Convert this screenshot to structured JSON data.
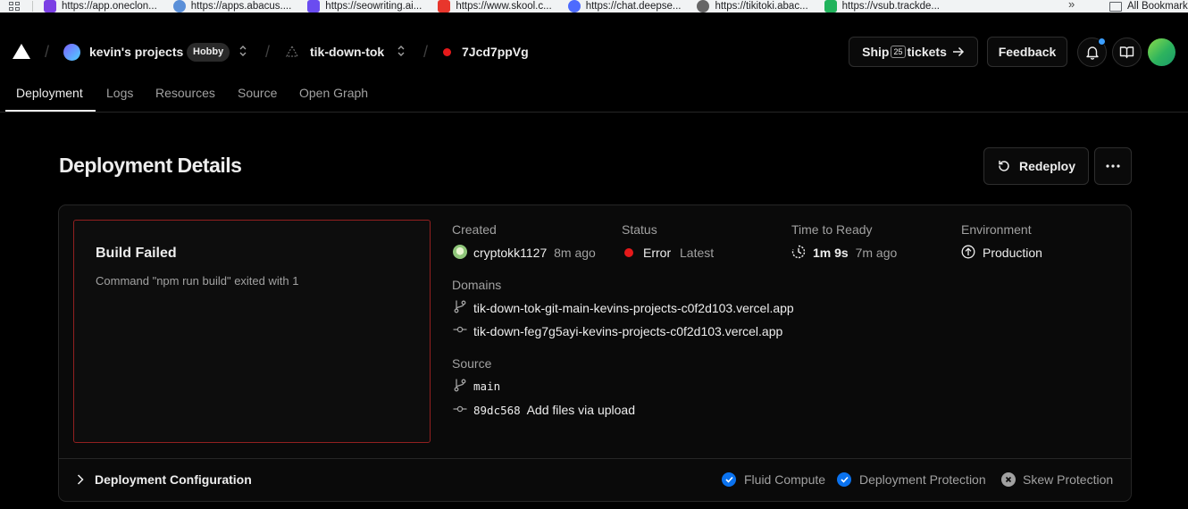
{
  "bookmarks": [
    {
      "label": "https://app.oneclon...",
      "color": "#7b3fe4"
    },
    {
      "label": "https://apps.abacus....",
      "color": "#5a8fd8"
    },
    {
      "label": "https://seowriting.ai...",
      "color": "#6a4cf0"
    },
    {
      "label": "https://www.skool.c...",
      "color": "#e8362c"
    },
    {
      "label": "https://chat.deepse...",
      "color": "#4d6bfe"
    },
    {
      "label": "https://tikitoki.abac...",
      "color": "#666666"
    },
    {
      "label": "https://vsub.trackde...",
      "color": "#21b35c"
    }
  ],
  "bookmarks_more": "»",
  "bookmarks_folder": "All Bookmarks",
  "header": {
    "team": "kevin's projects",
    "plan": "Hobby",
    "project": "tik-down-tok",
    "deployment_id": "7Jcd7ppVg",
    "ship_label_pre": "Ship",
    "ship_number": "25",
    "ship_label_post": "tickets",
    "feedback": "Feedback"
  },
  "tabs": [
    "Deployment",
    "Logs",
    "Resources",
    "Source",
    "Open Graph"
  ],
  "page_title": "Deployment Details",
  "actions": {
    "redeploy": "Redeploy"
  },
  "build": {
    "title": "Build Failed",
    "message": "Command \"npm run build\" exited with 1"
  },
  "details": {
    "created_label": "Created",
    "created_user": "cryptokk1127",
    "created_ago": "8m ago",
    "status_label": "Status",
    "status_value": "Error",
    "status_tag": "Latest",
    "ready_label": "Time to Ready",
    "ready_value": "1m 9s",
    "ready_ago": "7m ago",
    "env_label": "Environment",
    "env_value": "Production",
    "domains_label": "Domains",
    "domains": [
      "tik-down-tok-git-main-kevins-projects-c0f2d103.vercel.app",
      "tik-down-feg7g5ayi-kevins-projects-c0f2d103.vercel.app"
    ],
    "source_label": "Source",
    "branch": "main",
    "commit_hash": "89dc568",
    "commit_message": "Add files via upload"
  },
  "config": {
    "title": "Deployment Configuration",
    "features": [
      {
        "label": "Fluid Compute",
        "enabled": true
      },
      {
        "label": "Deployment Protection",
        "enabled": true
      },
      {
        "label": "Skew Protection",
        "enabled": false
      }
    ]
  },
  "colors": {
    "accent_blue": "#0a72ef",
    "error_red": "#e5191a",
    "error_border": "#922020"
  }
}
